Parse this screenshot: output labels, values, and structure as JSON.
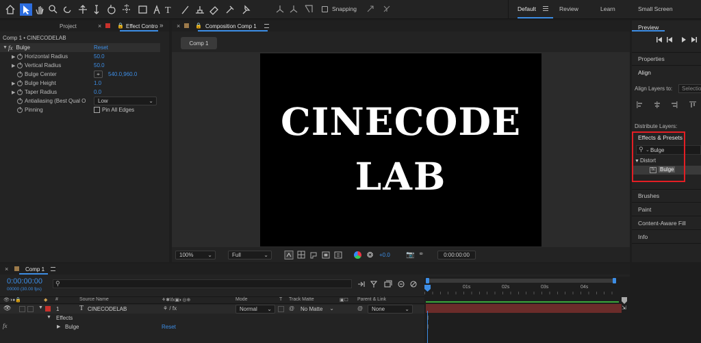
{
  "toolbar": {
    "snapping_label": "Snapping",
    "workspaces": [
      "Default",
      "Review",
      "Learn",
      "Small Screen"
    ],
    "tools": [
      "home-icon",
      "selection-arrow-icon",
      "hand-icon",
      "zoom-icon",
      "orbit-camera-icon",
      "move-camera-icon",
      "dolly-camera-icon",
      "rotate-icon",
      "pan-behind-icon",
      "rectangle-icon",
      "pen-icon",
      "text-icon",
      "brush-icon",
      "clone-stamp-icon",
      "eraser-icon",
      "roto-brush-icon",
      "puppet-pin-icon"
    ]
  },
  "left_panel": {
    "tabs": [
      "Project",
      "Effect Contro"
    ],
    "comp_layer": "Comp 1 • CINECODELAB",
    "effect": {
      "name": "Bulge",
      "reset": "Reset"
    },
    "properties": [
      {
        "name": "Horizontal Radius",
        "value": "50.0"
      },
      {
        "name": "Vertical Radius",
        "value": "50.0"
      },
      {
        "name": "Bulge Center",
        "value": "540.0,960.0"
      },
      {
        "name": "Bulge Height",
        "value": "1.0"
      },
      {
        "name": "Taper Radius",
        "value": "0.0"
      },
      {
        "name": "Antialiasing (Best Qual O",
        "value": "Low"
      },
      {
        "name": "Pinning",
        "value": "Pin All Edges"
      }
    ]
  },
  "composition": {
    "tab": "Composition Comp 1",
    "sub_tab": "Comp 1",
    "canvas_text_line1": "CINECODE",
    "canvas_text_line2": "LAB",
    "zoom": "100%",
    "resolution": "Full",
    "exposure": "+0.0",
    "timecode": "0:00:00:00"
  },
  "right_panel": {
    "preview": "Preview",
    "properties": "Properties",
    "align": "Align",
    "align_layers_to": "Align Layers to:",
    "align_target": "Selectio",
    "distribute": "Distribute Layers:",
    "effects_presets": "Effects & Presets",
    "search_value": "Bulge",
    "category": "Distort",
    "result": "Bulge",
    "brushes": "Brushes",
    "paint": "Paint",
    "content_aware": "Content-Aware Fill",
    "info": "Info",
    "highlight_color": "#e31e24"
  },
  "timeline": {
    "tab": "Comp 1",
    "timecode": "0:00:00:00",
    "fps": "00000 (30.00 fps)",
    "columns": {
      "source": "Source Name",
      "mode": "Mode",
      "t": "T",
      "track": "Track Matte",
      "parent": "Parent & Link"
    },
    "layer": {
      "num": "1",
      "name": "CINECODELAB",
      "mode": "Normal",
      "track": "No Matte",
      "parent": "None"
    },
    "effects_label": "Effects",
    "effect_row": {
      "name": "Bulge",
      "reset": "Reset"
    },
    "ruler": [
      "0s",
      "01s",
      "02s",
      "03s",
      "04s"
    ],
    "fx": "fx",
    "layer_color": "#c8312c"
  }
}
